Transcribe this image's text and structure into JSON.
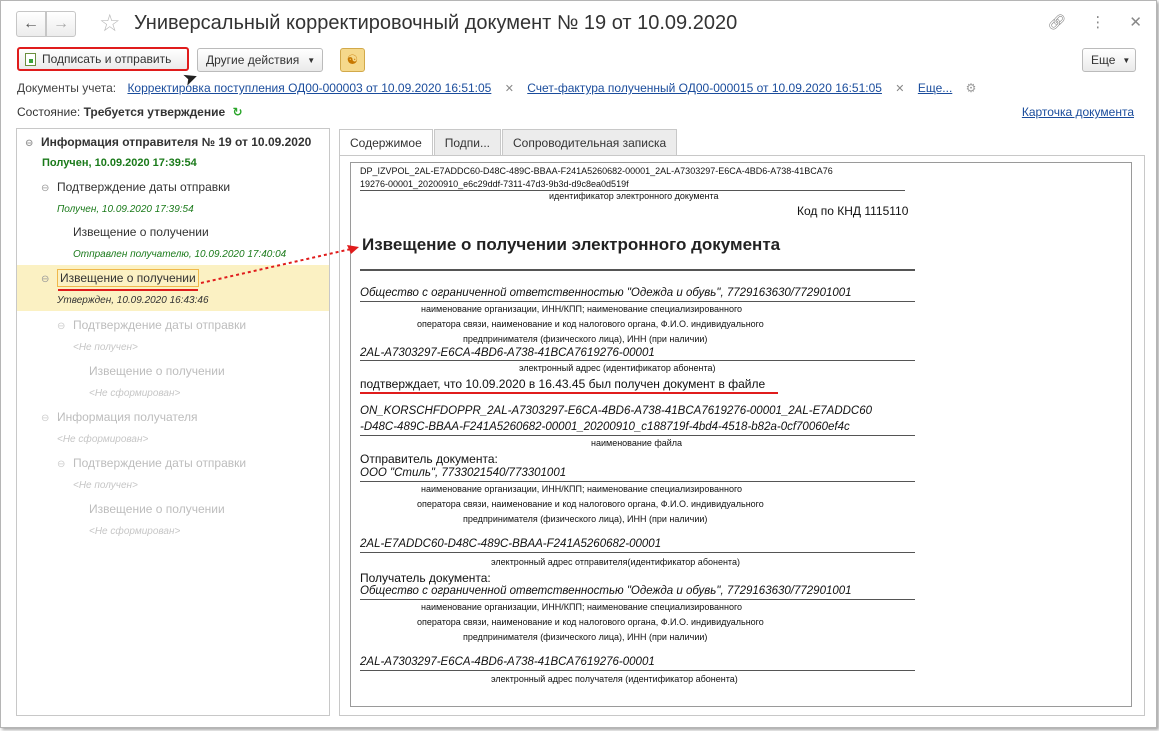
{
  "window": {
    "title": "Универсальный корректировочный документ № 19 от 10.09.2020"
  },
  "toolbar": {
    "sign_label": "Подписать и отправить",
    "other_actions_label": "Другие действия",
    "more_label": "Еще"
  },
  "docs_row": {
    "label": "Документы учета:",
    "link1": "Корректировка поступления ОД00-000003 от 10.09.2020 16:51:05",
    "link2": "Счет-фактура полученный ОД00-000015 от 10.09.2020 16:51:05",
    "more_link": "Еще..."
  },
  "state_row": {
    "label": "Состояние:",
    "value": "Требуется утверждение",
    "card_link": "Карточка документа"
  },
  "tree": {
    "root_title": "Информация отправителя № 19 от 10.09.2020",
    "root_status": "Получен, 10.09.2020 17:39:54",
    "n1_title": "Подтверждение даты отправки",
    "n1_status": "Получен, 10.09.2020 17:39:54",
    "n2_title": "Извещение о получении",
    "n2_status": "Отправлен получателю, 10.09.2020 17:40:04",
    "n3_title": "Извещение о получении",
    "n3_status": "Утвержден, 10.09.2020 16:43:46",
    "n4_title": "Подтверждение даты отправки",
    "n4_status": "<Не получен>",
    "n5_title": "Извещение о получении",
    "n5_status": "<Не сформирован>",
    "n6_title": "Информация получателя",
    "n6_status": "<Не сформирован>",
    "n7_title": "Подтверждение даты отправки",
    "n7_status": "<Не получен>",
    "n8_title": "Извещение о получении",
    "n8_status": "<Не сформирован>"
  },
  "tabs": [
    "Содержимое",
    "Подпи...",
    "Сопроводительная записка"
  ],
  "doc": {
    "file_id_line1": "DP_IZVPOL_2AL-E7ADDC60-D48C-489C-BBAA-F241A5260682-00001_2AL-A7303297-E6CA-4BD6-A738-41BCA76",
    "file_id_line2": "19276-00001_20200910_e6c29ddf-7311-47d3-9b3d-d9c8ea0d519f",
    "file_id_caption": "идентификатор электронного документа",
    "knd": "Код по КНД 1115110",
    "heading": "Извещение о получении электронного документа",
    "org1": "Общество с ограниченной ответственностью \"Одежда и обувь\", 7729163630/772901001",
    "org_caption_1": "наименование организации, ИНН/КПП; наименование специализированного",
    "org_caption_2": "оператора связи, наименование и код налогового органа, Ф.И.О. индивидуального",
    "org_caption_3": "предпринимателя (физического лица), ИНН (при наличии)",
    "addr1": "2AL-A7303297-E6CA-4BD6-A738-41BCA7619276-00001",
    "addr1_caption": "электронный адрес (идентификатор абонента)",
    "confirm": "подтверждает, что 10.09.2020 в 16.43.45 был получен документ в файле",
    "filename1": "ON_KORSCHFDOPPR_2AL-A7303297-E6CA-4BD6-A738-41BCA7619276-00001_2AL-E7ADDC60",
    "filename2": "-D48C-489C-BBAA-F241A5260682-00001_20200910_c188719f-4bd4-4518-b82a-0cf70060ef4c",
    "filename_caption": "наименование файла",
    "sender_label": "Отправитель документа:",
    "sender": "ООО \"Стиль\", 7733021540/773301001",
    "sender_caption_1": "наименование организации, ИНН/КПП; наименование специализированного",
    "sender_caption_2": "оператора связи, наименование и код налогового органа, Ф.И.О. индивидуального",
    "sender_caption_3": "предпринимателя (физического лица), ИНН (при наличии)",
    "sender_addr": "2AL-E7ADDC60-D48C-489C-BBAA-F241A5260682-00001",
    "sender_addr_caption": "электронный адрес отправителя(идентификатор абонента)",
    "receiver_label": "Получатель документа:",
    "receiver": "Общество с ограниченной ответственностью \"Одежда и обувь\", 7729163630/772901001",
    "receiver_caption_1": "наименование организации, ИНН/КПП; наименование специализированного",
    "receiver_caption_2": "оператора связи, наименование и код налогового органа, Ф.И.О. индивидуального",
    "receiver_caption_3": "предпринимателя (физического лица), ИНН (при наличии)",
    "receiver_addr": "2AL-A7303297-E6CA-4BD6-A738-41BCA7619276-00001",
    "receiver_addr_caption": "электронный адрес получателя (идентификатор абонента)"
  },
  "icons": {
    "back": "arrow-left-icon",
    "forward": "arrow-right-icon",
    "favorite": "star-icon",
    "link": "link-icon",
    "menu": "kebab-menu-icon",
    "close": "close-icon",
    "refresh": "refresh-icon",
    "settings": "gear-icon",
    "structure": "org-structure-icon"
  },
  "colors": {
    "highlight_red": "#e01c1c",
    "link_blue": "#1a4c9c",
    "status_green": "#1a7a1a",
    "selection_bg": "#fbf1c3"
  }
}
